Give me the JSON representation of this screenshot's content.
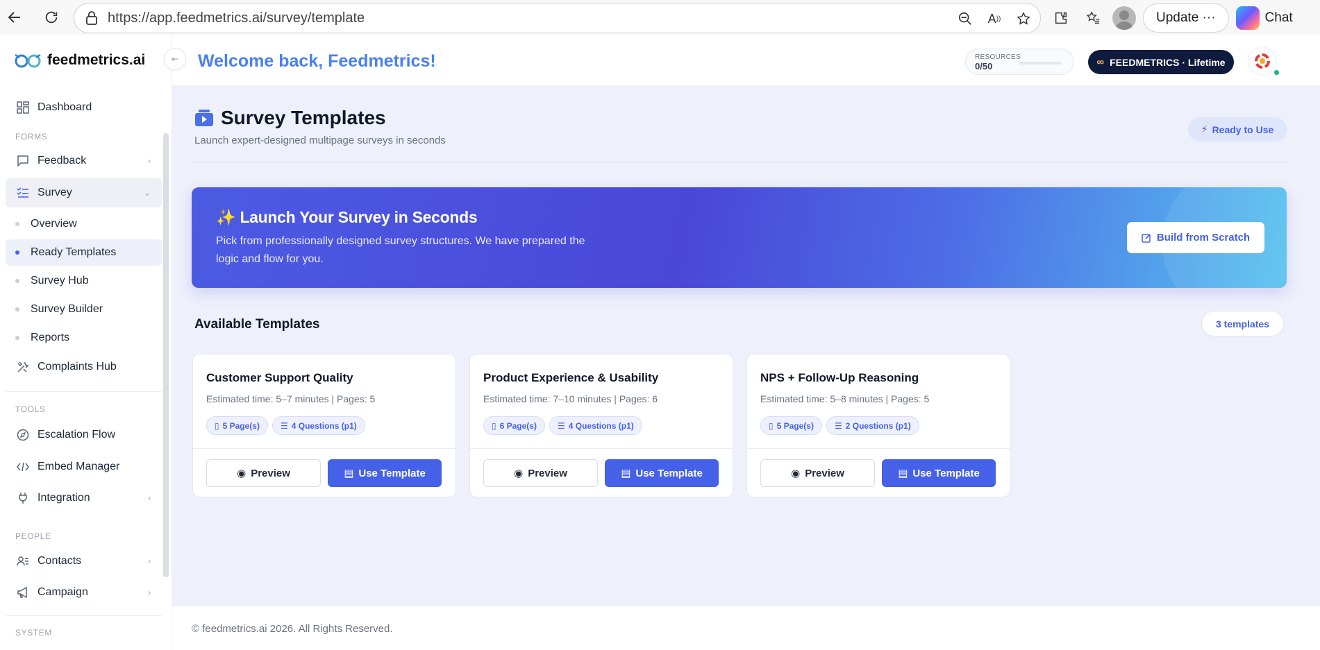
{
  "browser": {
    "url": "https://app.feedmetrics.ai/survey/template",
    "update_label": "Update",
    "chat_label": "Chat"
  },
  "app": {
    "brand": "feedmetrics.ai",
    "welcome": "Welcome back, Feedmetrics!",
    "resources_label": "RESOURCES",
    "resources_value": "0/50",
    "plan_label": "FEEDMETRICS · Lifetime",
    "accent_color": "#4461e8"
  },
  "sidebar": {
    "dashboard": "Dashboard",
    "forms_section": "FORMS",
    "feedback": "Feedback",
    "survey": "Survey",
    "survey_subitems": [
      "Overview",
      "Ready Templates",
      "Survey Hub",
      "Survey Builder",
      "Reports"
    ],
    "complaints": "Complaints Hub",
    "tools_section": "TOOLS",
    "escalation": "Escalation Flow",
    "embed": "Embed Manager",
    "integration": "Integration",
    "people_section": "PEOPLE",
    "contacts": "Contacts",
    "campaign": "Campaign",
    "system_section": "SYSTEM"
  },
  "page": {
    "title": "Survey Templates",
    "subtitle": "Launch expert-designed multipage surveys in seconds",
    "ready_badge": "Ready to Use"
  },
  "hero": {
    "title": "Launch Your Survey in Seconds",
    "emoji": "✨",
    "description": "Pick from professionally designed survey structures. We have prepared the logic and flow for you.",
    "build_label": "Build from Scratch"
  },
  "templates_section": {
    "heading": "Available Templates",
    "count": "3 templates"
  },
  "templates": [
    {
      "title": "Customer Support Quality",
      "meta": "Estimated time: 5–7 minutes | Pages: 5",
      "pages_chip": "5 Page(s)",
      "questions_chip": "4 Questions (p1)",
      "preview": "Preview",
      "use": "Use Template"
    },
    {
      "title": "Product Experience & Usability",
      "meta": "Estimated time: 7–10 minutes | Pages: 6",
      "pages_chip": "6 Page(s)",
      "questions_chip": "4 Questions (p1)",
      "preview": "Preview",
      "use": "Use Template"
    },
    {
      "title": "NPS + Follow-Up Reasoning",
      "meta": "Estimated time: 5–8 minutes | Pages: 5",
      "pages_chip": "5 Page(s)",
      "questions_chip": "2 Questions (p1)",
      "preview": "Preview",
      "use": "Use Template"
    }
  ],
  "footer": {
    "text": "© feedmetrics.ai 2026. All Rights Reserved."
  }
}
